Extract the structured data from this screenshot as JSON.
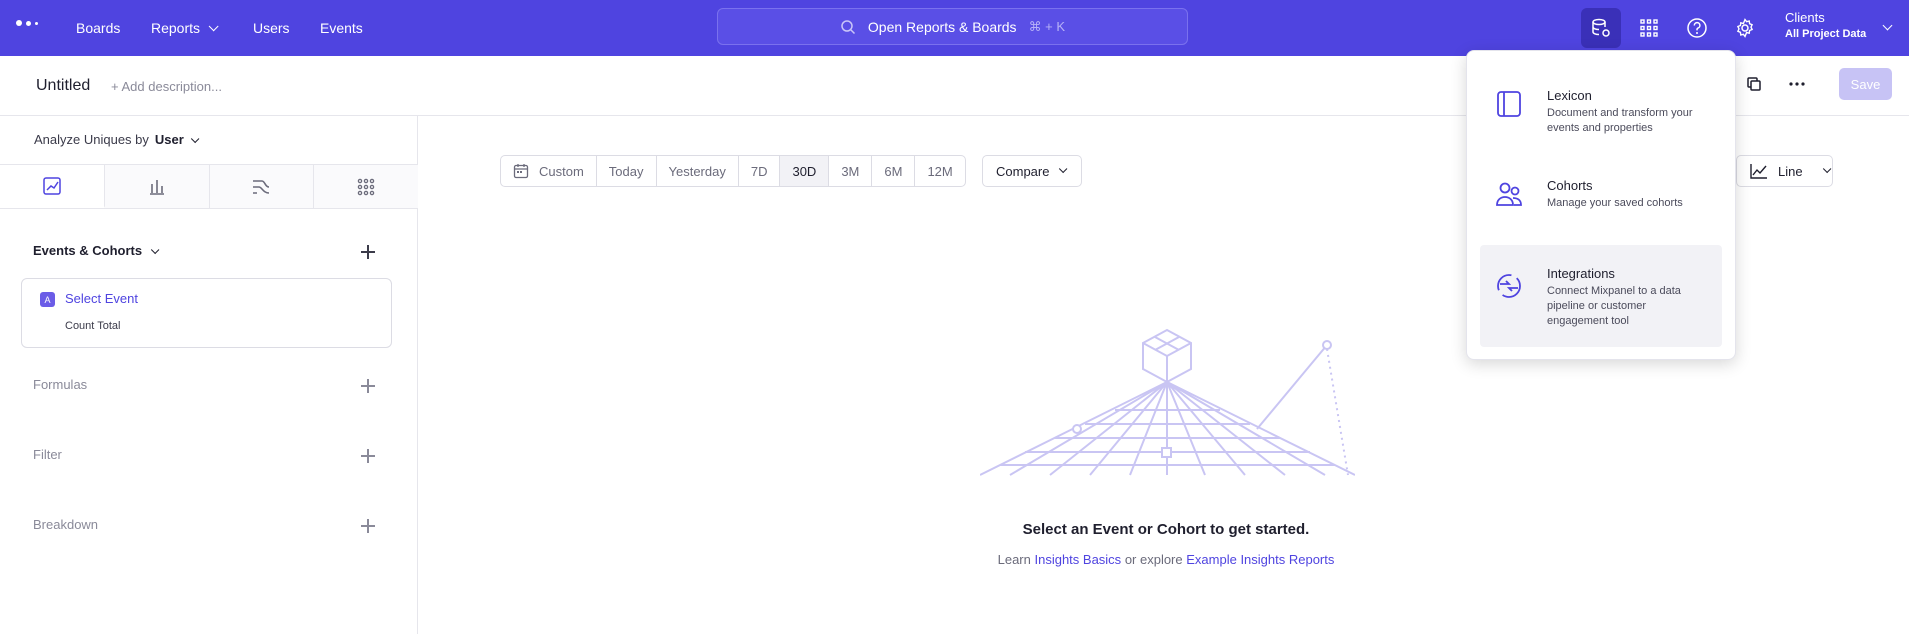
{
  "nav": {
    "items": [
      "Boards",
      "Reports",
      "Users",
      "Events"
    ],
    "search_label": "Open Reports & Boards",
    "search_shortcut": "⌘ + K",
    "clients_title": "Clients",
    "clients_sub": "All Project Data"
  },
  "header": {
    "title": "Untitled",
    "add_description": "+ Add description...",
    "save_label": "Save"
  },
  "sidebar": {
    "analyze_prefix": "Analyze Uniques by",
    "analyze_value": "User",
    "events_header": "Events & Cohorts",
    "event_badge": "A",
    "event_name": "Select Event",
    "event_measure": "Count Total",
    "formulas": "Formulas",
    "filter": "Filter",
    "breakdown": "Breakdown"
  },
  "toolbar": {
    "custom": "Custom",
    "ranges": [
      "Today",
      "Yesterday",
      "7D",
      "30D",
      "3M",
      "6M",
      "12M"
    ],
    "active_range": "30D",
    "compare": "Compare",
    "chart_type": "Line"
  },
  "empty": {
    "title": "Select an Event or Cohort to get started.",
    "learn": "Learn",
    "basics_link": "Insights Basics",
    "or_explore": "or explore",
    "examples_link": "Example Insights Reports"
  },
  "dropdown": {
    "items": [
      {
        "title": "Lexicon",
        "desc": "Document and transform your events and properties",
        "icon": "book-icon"
      },
      {
        "title": "Cohorts",
        "desc": "Manage your saved cohorts",
        "icon": "users-icon"
      },
      {
        "title": "Integrations",
        "desc": "Connect Mixpanel to a data pipeline or customer engagement tool",
        "icon": "integration-icon"
      }
    ]
  },
  "colors": {
    "brand": "#4f44e0",
    "link": "#4f44e0",
    "save_disabled": "#c7c3f5"
  }
}
